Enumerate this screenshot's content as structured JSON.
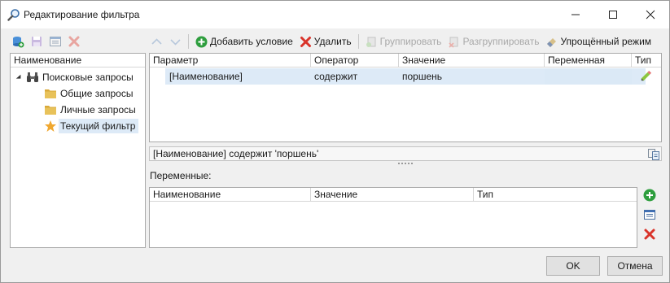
{
  "window": {
    "title": "Редактирование фильтра"
  },
  "toolbar": {
    "add_condition": "Добавить условие",
    "delete": "Удалить",
    "group": "Группировать",
    "ungroup": "Разгруппировать",
    "simple_mode": "Упрощённый режим"
  },
  "tree": {
    "header": "Наименование",
    "root": "Поисковые запросы",
    "items": [
      "Общие запросы",
      "Личные запросы",
      "Текущий фильтр"
    ]
  },
  "conditions": {
    "columns": [
      "Параметр",
      "Оператор",
      "Значение",
      "Переменная",
      "Тип"
    ],
    "rows": [
      {
        "parameter": "[Наименование]",
        "operator": "содержит",
        "value": "поршень",
        "variable": ""
      }
    ]
  },
  "expression": "[Наименование] содержит 'поршень'",
  "variables": {
    "label": "Переменные:",
    "columns": [
      "Наименование",
      "Значение",
      "Тип"
    ]
  },
  "buttons": {
    "ok": "OK",
    "cancel": "Отмена"
  },
  "colors": {
    "selection": "#ddeaf7",
    "add_green": "#2e9e3e",
    "delete_red": "#d9342b",
    "folder_yellow": "#e8c25a",
    "star_orange": "#f0a830"
  }
}
